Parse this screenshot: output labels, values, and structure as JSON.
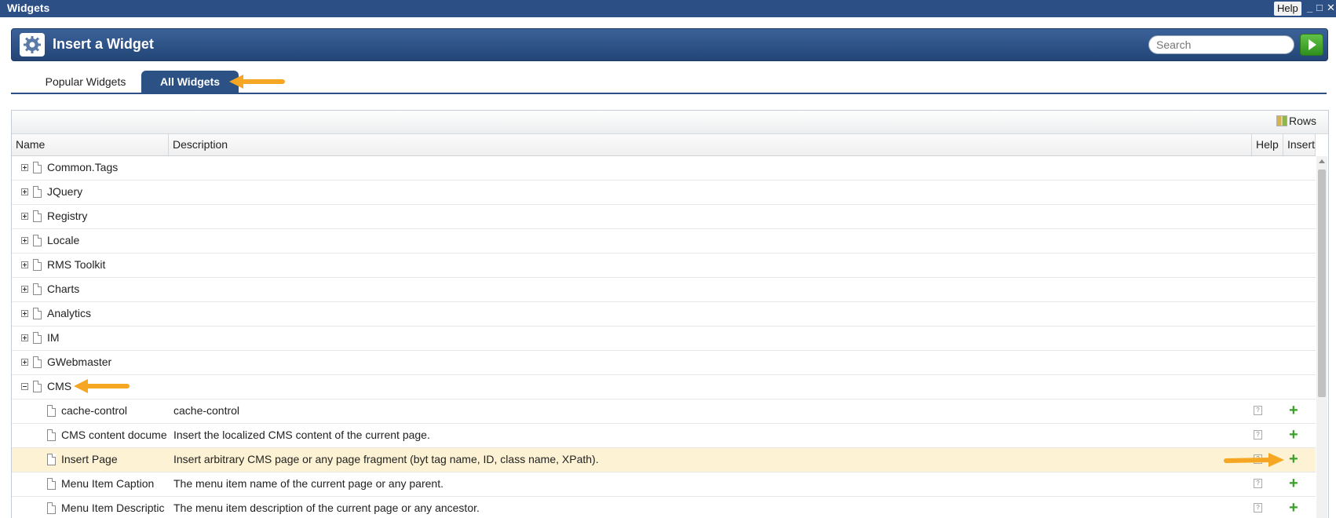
{
  "window": {
    "title": "Widgets",
    "help_label": "Help",
    "minimize": "_",
    "maximize": "□",
    "close": "✕"
  },
  "header": {
    "title": "Insert a Widget",
    "search_placeholder": "Search"
  },
  "tabs": [
    {
      "label": "Popular Widgets"
    },
    {
      "label": "All Widgets",
      "active": true
    }
  ],
  "toolbar": {
    "rows_label": "Rows"
  },
  "columns": {
    "name": "Name",
    "description": "Description",
    "help": "Help",
    "insert": "Insert"
  },
  "rows": [
    {
      "name": "Common.Tags",
      "description": "",
      "expand": "plus"
    },
    {
      "name": "JQuery",
      "description": "",
      "expand": "plus"
    },
    {
      "name": "Registry",
      "description": "",
      "expand": "plus"
    },
    {
      "name": "Locale",
      "description": "",
      "expand": "plus"
    },
    {
      "name": "RMS Toolkit",
      "description": "",
      "expand": "plus"
    },
    {
      "name": "Charts",
      "description": "",
      "expand": "plus"
    },
    {
      "name": "Analytics",
      "description": "",
      "expand": "plus"
    },
    {
      "name": "IM",
      "description": "",
      "expand": "plus"
    },
    {
      "name": "GWebmaster",
      "description": "",
      "expand": "plus"
    },
    {
      "name": "CMS",
      "description": "",
      "expand": "minus"
    },
    {
      "name": "cache-control",
      "description": "cache-control",
      "child": true
    },
    {
      "name": "CMS content docume",
      "description": "Insert the localized CMS content of the current page.",
      "child": true
    },
    {
      "name": "Insert Page",
      "description": "Insert arbitrary CMS page or any page fragment (byt tag name, ID, class name, XPath).",
      "child": true,
      "selected": true
    },
    {
      "name": "Menu Item Caption",
      "description": "The menu item name of the current page or any parent.",
      "child": true
    },
    {
      "name": "Menu Item Descriptic",
      "description": "The menu item description of the current page or any ancestor.",
      "child": true
    }
  ],
  "colors": {
    "titlebar": "#2c4f86",
    "selected_row": "#fdf2d3",
    "annotation_arrow": "#f5a623",
    "insert_plus": "#3aa02a"
  }
}
